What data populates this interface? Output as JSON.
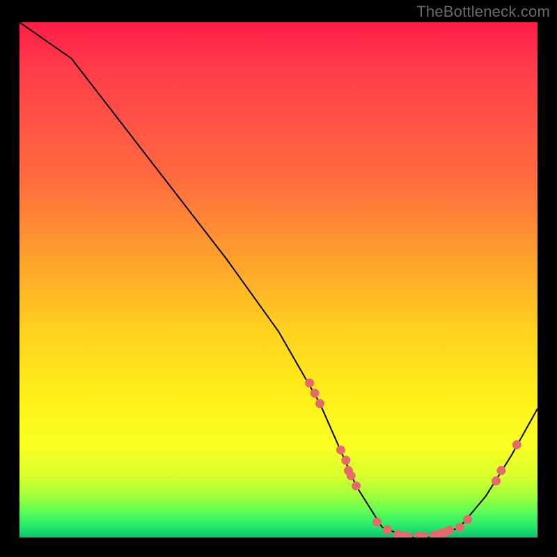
{
  "attribution": "TheBottleneck.com",
  "chart_data": {
    "type": "line",
    "title": "",
    "xlabel": "",
    "ylabel": "",
    "xlim": [
      0,
      100
    ],
    "ylim": [
      0,
      100
    ],
    "x": [
      0,
      10,
      20,
      30,
      40,
      50,
      58,
      65,
      70,
      75,
      80,
      85,
      90,
      95,
      100
    ],
    "values": [
      100,
      93,
      80,
      67,
      54,
      40,
      26,
      10,
      2,
      0,
      0,
      2,
      8,
      16,
      25
    ],
    "series": [
      {
        "name": "bottleneck-curve",
        "x": [
          0,
          10,
          20,
          30,
          40,
          50,
          58,
          65,
          70,
          75,
          80,
          85,
          90,
          95,
          100
        ],
        "values": [
          100,
          93,
          80,
          67,
          54,
          40,
          26,
          10,
          2,
          0,
          0,
          2,
          8,
          16,
          25
        ]
      }
    ],
    "markers": [
      {
        "x": 56,
        "y": 30
      },
      {
        "x": 57,
        "y": 28
      },
      {
        "x": 58,
        "y": 26
      },
      {
        "x": 62,
        "y": 17
      },
      {
        "x": 63,
        "y": 15
      },
      {
        "x": 63.5,
        "y": 13
      },
      {
        "x": 64,
        "y": 12
      },
      {
        "x": 65,
        "y": 10
      },
      {
        "x": 69,
        "y": 3
      },
      {
        "x": 71,
        "y": 1.5
      },
      {
        "x": 73,
        "y": 0.5
      },
      {
        "x": 74,
        "y": 0.3
      },
      {
        "x": 75,
        "y": 0.2
      },
      {
        "x": 77,
        "y": 0.2
      },
      {
        "x": 78,
        "y": 0.3
      },
      {
        "x": 80,
        "y": 0.4
      },
      {
        "x": 81,
        "y": 0.7
      },
      {
        "x": 82,
        "y": 1.0
      },
      {
        "x": 83,
        "y": 1.4
      },
      {
        "x": 85,
        "y": 2
      },
      {
        "x": 86.5,
        "y": 3.5
      },
      {
        "x": 92,
        "y": 11
      },
      {
        "x": 93,
        "y": 13
      },
      {
        "x": 96,
        "y": 18
      }
    ],
    "background_gradient": {
      "top": "#ff1c48",
      "mid": "#fff21a",
      "bottom": "#0fbf6c"
    }
  }
}
